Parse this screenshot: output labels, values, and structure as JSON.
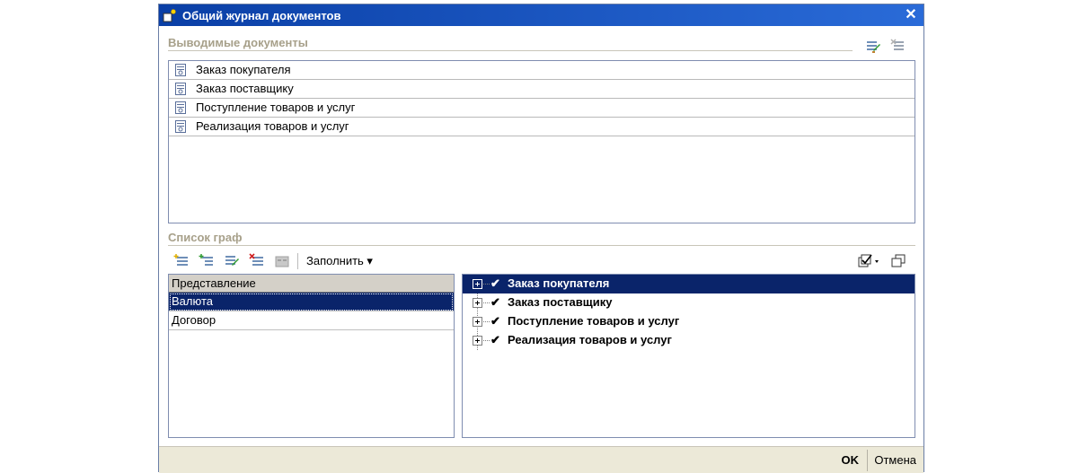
{
  "window": {
    "title": "Общий журнал документов",
    "close_label": "✕"
  },
  "documents_section": {
    "label": "Выводимые документы",
    "items": [
      {
        "label": "Заказ покупателя"
      },
      {
        "label": "Заказ поставщику"
      },
      {
        "label": "Поступление товаров и услуг"
      },
      {
        "label": "Реализация товаров и услуг"
      }
    ]
  },
  "columns_section": {
    "label": "Список граф",
    "fill_button_label": "Заполнить ▾"
  },
  "left_table": {
    "header": "Представление",
    "rows": [
      {
        "label": "Валюта",
        "selected": true
      },
      {
        "label": "Договор",
        "selected": false
      }
    ]
  },
  "right_tree": {
    "rows": [
      {
        "label": "Заказ покупателя",
        "selected": true
      },
      {
        "label": "Заказ поставщику",
        "selected": false
      },
      {
        "label": "Поступление товаров и услуг",
        "selected": false
      },
      {
        "label": "Реализация товаров и услуг",
        "selected": false
      }
    ]
  },
  "footer": {
    "ok_label": "OK",
    "cancel_label": "Отмена"
  },
  "colors": {
    "titlebar": "#0a3fa6",
    "selection": "#0a246a",
    "section_label": "#a7a08a",
    "footer_bg": "#ece9d8"
  }
}
